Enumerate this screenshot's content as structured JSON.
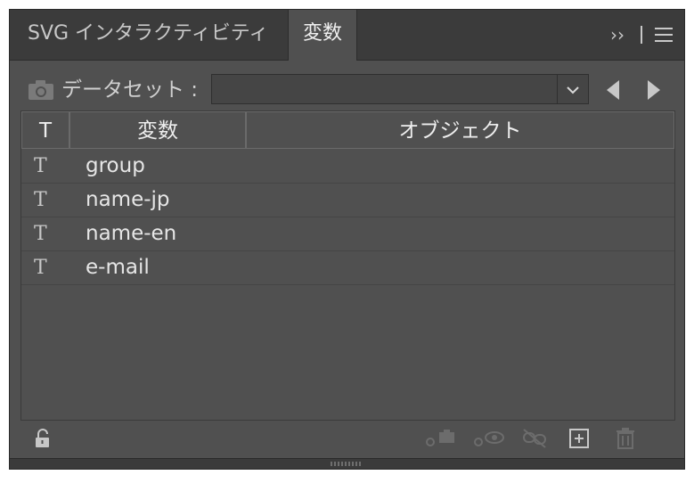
{
  "tabs": [
    {
      "label": "SVG インタラクティビティ",
      "active": false
    },
    {
      "label": "変数",
      "active": true
    }
  ],
  "tab_controls": {
    "expand": "››",
    "menu_icon": "hamburger-menu-icon"
  },
  "dataset": {
    "label": "データセット :",
    "value": ""
  },
  "table": {
    "headers": {
      "type": "T",
      "variable": "変数",
      "object": "オブジェクト"
    },
    "rows": [
      {
        "type": "T",
        "name": "group"
      },
      {
        "type": "T",
        "name": "name-jp"
      },
      {
        "type": "T",
        "name": "name-en"
      },
      {
        "type": "T",
        "name": "e-mail"
      }
    ]
  },
  "footer_icons": [
    "unlock-icon",
    "capture-dataset-icon",
    "visibility-variable-icon",
    "unbind-icon",
    "new-variable-icon",
    "trash-icon"
  ],
  "colors": {
    "panel": "#505050",
    "tabbar": "#3b3b3b",
    "text": "#e6e6e6",
    "icon": "#c8c8c8"
  }
}
